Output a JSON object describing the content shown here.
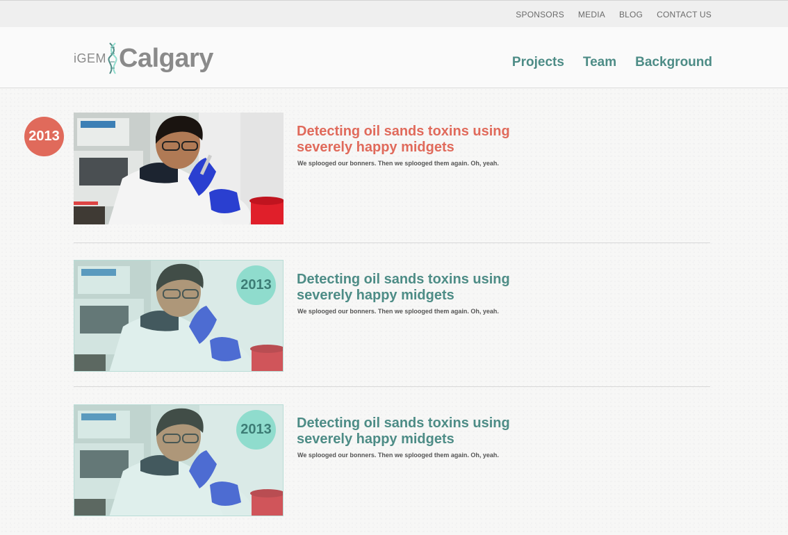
{
  "utility_nav": [
    "SPONSORS",
    "MEDIA",
    "BLOG",
    "CONTACT US"
  ],
  "logo": {
    "prefix": "iGEM",
    "name": "Calgary"
  },
  "main_nav": [
    "Projects",
    "Team",
    "Background"
  ],
  "entries": [
    {
      "year": "2013",
      "title_line1": "Detecting oil sands toxins using",
      "title_line2": "severely happy midgets",
      "description": "We splooged our bonners. Then we splooged them again. Oh, yeah.",
      "state": "active"
    },
    {
      "year": "2013",
      "title_line1": "Detecting oil sands toxins using",
      "title_line2": "severely happy midgets",
      "description": "We splooged our bonners. Then we splooged them again. Oh, yeah.",
      "state": "faded"
    },
    {
      "year": "2013",
      "title_line1": "Detecting oil sands toxins using",
      "title_line2": "severely happy midgets",
      "description": "We splooged our bonners. Then we splooged them again. Oh, yeah.",
      "state": "faded"
    }
  ],
  "colors": {
    "accent_red": "#e06a5b",
    "accent_teal": "#4d8c86",
    "badge_teal": "#8fdccd"
  }
}
